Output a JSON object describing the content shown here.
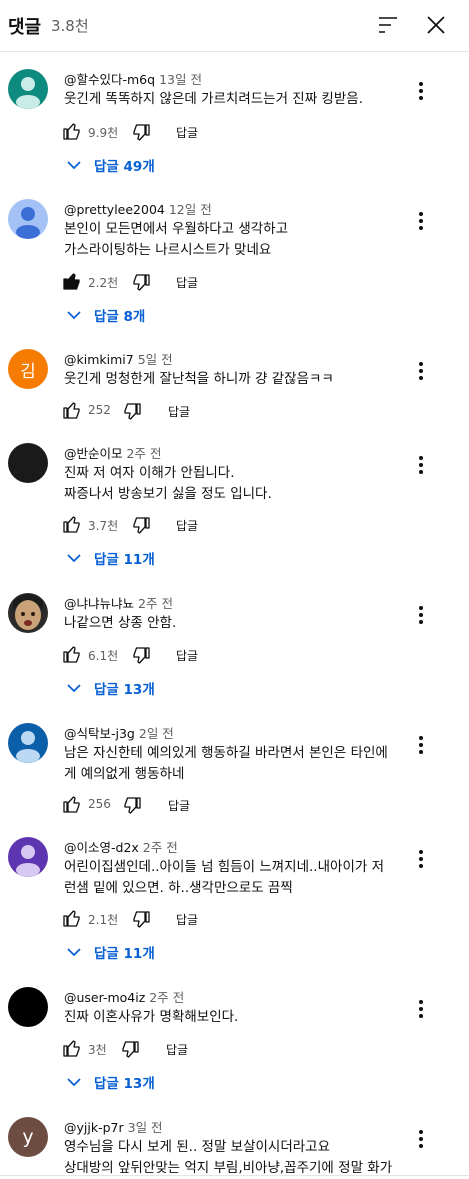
{
  "header": {
    "title": "댓글",
    "count": "3.8천"
  },
  "comments": [
    {
      "author": "@할수있다-m6q",
      "time": "13일 전",
      "text": "웃긴게 똑똑하지 않은데 가르치려드는거 진짜 킹받음.",
      "likes": "9.9천",
      "reply_label": "답글",
      "replies": "답글 49개",
      "avatar": {
        "type": "person",
        "bg": "#0f8a7e"
      }
    },
    {
      "author": "@prettylee2004",
      "time": "12일 전",
      "text": "본인이 모든면에서 우월하다고 생각하고\n가스라이팅하는 나르시스트가 맞네요",
      "likes": "2.2천",
      "reply_label": "답글",
      "replies": "답글 8개",
      "avatar": {
        "type": "person",
        "bg": "#a5c2f7",
        "fg": "#3b6fd6"
      },
      "liked": true
    },
    {
      "author": "@kimkimi7",
      "time": "5일 전",
      "text": "웃긴게 멍청한게 잘난척을 하니까 걍 같잖음ㅋㅋ",
      "likes": "252",
      "reply_label": "답글",
      "replies": "",
      "avatar": {
        "type": "letter",
        "letter": "김",
        "bg": "#f57c00"
      }
    },
    {
      "author": "@반순이모",
      "time": "2주 전",
      "text": "진짜 저 여자 이해가 안됩니다.\n짜증나서 방송보기 싫을 정도 입니다.",
      "likes": "3.7천",
      "reply_label": "답글",
      "replies": "답글 11개",
      "avatar": {
        "type": "plain",
        "bg": "#1a1a1a"
      }
    },
    {
      "author": "@냐냐뉴냐뇨",
      "time": "2주 전",
      "text": "나같으면 상종 안함.",
      "likes": "6.1천",
      "reply_label": "답글",
      "replies": "답글 13개",
      "avatar": {
        "type": "photo",
        "bg": "#c9a27a"
      }
    },
    {
      "author": "@식탁보-j3g",
      "time": "2일 전",
      "text": "남은 자신한테 예의있게 행동하길 바라면서 본인은 타인에\n게 예의없게 행동하네",
      "likes": "256",
      "reply_label": "답글",
      "replies": "",
      "avatar": {
        "type": "person",
        "bg": "#0b5fa8"
      }
    },
    {
      "author": "@이소영-d2x",
      "time": "2주 전",
      "text": "어린이집샘인데..아이들 넘 힘듬이 느껴지네..내아이가 저\n런샘 밑에 있으면. 하..생각만으로도 끔찍",
      "likes": "2.1천",
      "reply_label": "답글",
      "replies": "답글 11개",
      "avatar": {
        "type": "person",
        "bg": "#5e35b1"
      }
    },
    {
      "author": "@user-mo4iz",
      "time": "2주 전",
      "text": "진짜 이혼사유가 명확해보인다.",
      "likes": "3천",
      "reply_label": "답글",
      "replies": "답글 13개",
      "avatar": {
        "type": "plain",
        "bg": "#000000"
      }
    },
    {
      "author": "@yjjk-p7r",
      "time": "3일 전",
      "text": "영수님을 다시 보게 된.. 정말 보살이시더라고요\n상대방의 앞뒤안맞는 억지 부림,비아냥,꼽주기에 정말 화가",
      "likes": "",
      "reply_label": "",
      "replies": "",
      "avatar": {
        "type": "letter",
        "letter": "y",
        "bg": "#6d4c41"
      }
    }
  ]
}
